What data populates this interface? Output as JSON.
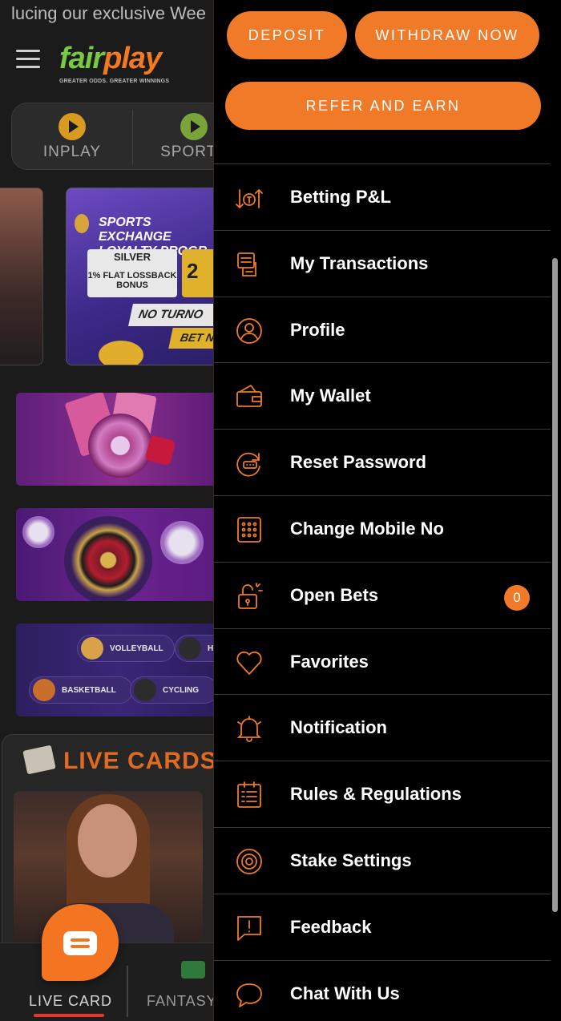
{
  "colors": {
    "accent": "#f07a27",
    "drawer_bg": "#000000",
    "page_bg": "#1b1b1b",
    "brand_green": "#7ac943"
  },
  "background": {
    "ticker_text": "lucing our exclusive Wee",
    "logo": {
      "part1": "fair",
      "part2": "play"
    },
    "tagline": "GREATER ODDS. GREATER WINNINGS",
    "nav_tabs": [
      {
        "label": "INPLAY",
        "icon": "play-icon"
      },
      {
        "label": "SPORTS",
        "icon": "sports-icon"
      }
    ],
    "promo_banner": {
      "title": "SPORTS EXCHANGE LOYALTY PROGR",
      "tier": "SILVER",
      "bonus": "1% FLAT LOSSBACK BONUS",
      "tier_value": "2",
      "note1": "NO TURNO",
      "note2": "BET N"
    },
    "sports_pills": [
      "VOLLEYBALL",
      "H",
      "BASKETBALL",
      "CYCLING"
    ],
    "live_section_title": "LIVE CARDS",
    "bottom_nav": [
      {
        "label": "LIVE CARD",
        "active": true
      },
      {
        "label": "FANTASY",
        "active": false
      }
    ]
  },
  "drawer": {
    "deposit_label": "DEPOSIT",
    "withdraw_label": "WITHDRAW NOW",
    "refer_label": "REFER AND EARN",
    "menu": [
      {
        "label": "Betting P&L",
        "icon": "betting-pl-icon"
      },
      {
        "label": "My Transactions",
        "icon": "transactions-icon"
      },
      {
        "label": "Profile",
        "icon": "profile-icon"
      },
      {
        "label": "My Wallet",
        "icon": "wallet-icon"
      },
      {
        "label": "Reset Password",
        "icon": "reset-password-icon"
      },
      {
        "label": "Change Mobile No",
        "icon": "mobile-icon"
      },
      {
        "label": "Open Bets",
        "icon": "open-bets-icon",
        "badge": "0"
      },
      {
        "label": "Favorites",
        "icon": "heart-icon"
      },
      {
        "label": "Notification",
        "icon": "bell-icon"
      },
      {
        "label": "Rules & Regulations",
        "icon": "rules-icon"
      },
      {
        "label": "Stake Settings",
        "icon": "settings-icon"
      },
      {
        "label": "Feedback",
        "icon": "feedback-icon"
      },
      {
        "label": "Chat With Us",
        "icon": "chat-icon"
      }
    ]
  }
}
